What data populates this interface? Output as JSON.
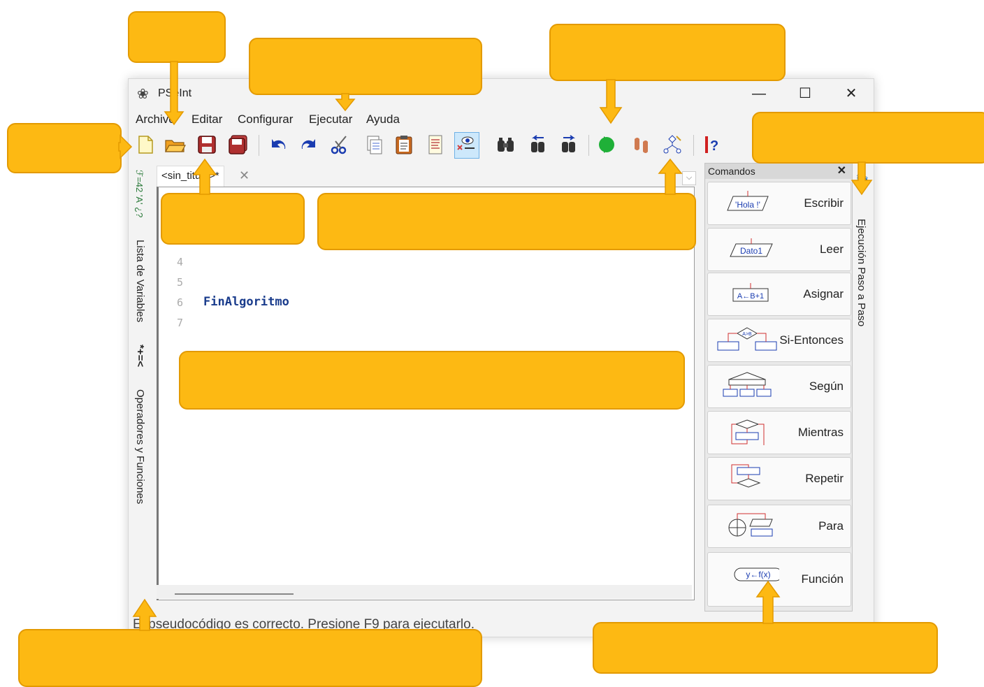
{
  "window": {
    "title": "PSeInt",
    "minimize_glyph": "—",
    "maximize_glyph": "☐",
    "close_glyph": "✕"
  },
  "menu": [
    {
      "label": "Archivo"
    },
    {
      "label": "Editar"
    },
    {
      "label": "Configurar"
    },
    {
      "label": "Ejecutar"
    },
    {
      "label": "Ayuda"
    }
  ],
  "toolbar": {
    "icons": [
      "new-file-icon",
      "open-folder-icon",
      "save-icon",
      "save-as-icon",
      "undo-icon",
      "redo-icon",
      "cut-icon",
      "copy-icon",
      "paste-icon",
      "edit-flowchart-icon",
      "view-icon",
      "search-icon",
      "search-prev-icon",
      "search-next-icon",
      "run-icon",
      "step-by-step-icon",
      "draw-flowchart-icon",
      "help-icon"
    ]
  },
  "editor": {
    "tab_label": "<sin_titulo>*",
    "tab_close": "✕",
    "lines": [
      {
        "num": "4",
        "code": ""
      },
      {
        "num": "5",
        "code": ""
      },
      {
        "num": "6",
        "code": "FinAlgoritmo"
      },
      {
        "num": "7",
        "code": ""
      }
    ]
  },
  "left_sidebar": {
    "variables_icon_text": "ℱ=42 'A' ¿?",
    "variables_label": "Lista de Variables",
    "operators_icon_text": "*+=<",
    "operators_label": "Operadores y Funciones"
  },
  "right_sidebar": {
    "step_label": "Ejecución Paso a Paso"
  },
  "commands": {
    "title": "Comandos",
    "close_glyph": "✕",
    "items": [
      {
        "label": "Escribir",
        "icon_text": "'Hola !'"
      },
      {
        "label": "Leer",
        "icon_text": "Dato1"
      },
      {
        "label": "Asignar",
        "icon_text": "A←B+1"
      },
      {
        "label": "Si-Entonces",
        "icon_text": "A>B"
      },
      {
        "label": "Según",
        "icon_text": ""
      },
      {
        "label": "Mientras",
        "icon_text": ""
      },
      {
        "label": "Repetir",
        "icon_text": ""
      },
      {
        "label": "Para",
        "icon_text": ""
      },
      {
        "label": "Función",
        "icon_text": "y←f(x)"
      }
    ]
  },
  "status": "El pseudocódigo es correcto. Presione F9 para ejecutarlo.",
  "colors": {
    "callout": "#fdb913",
    "keyword": "#1a3c8c"
  }
}
